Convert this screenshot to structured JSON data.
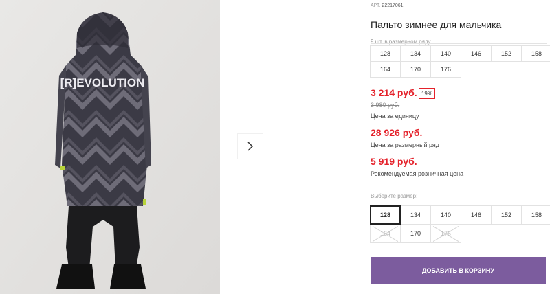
{
  "product": {
    "art_label": "АРТ.",
    "art_number": "22217061",
    "title": "Пальто зимнее для мальчика",
    "sizes_in_row": "9 шт. в размерном ряду",
    "row_sizes": [
      "128",
      "134",
      "140",
      "146",
      "152",
      "158",
      "164",
      "170",
      "176"
    ],
    "print_text": "[R]EVOLUTION"
  },
  "pricing": {
    "price": "3 214 руб.",
    "discount": "19%",
    "old_price": "3 980 руб.",
    "price_note": "Цена за единицу",
    "row_price": "28 926 руб.",
    "row_price_note": "Цена за размерный ряд",
    "retail_price": "5 919 руб.",
    "retail_note": "Рекомендуемая розничная цена"
  },
  "size_picker": {
    "label": "Выберите размер:",
    "options": [
      {
        "value": "128",
        "state": "selected"
      },
      {
        "value": "134",
        "state": "available"
      },
      {
        "value": "140",
        "state": "available"
      },
      {
        "value": "146",
        "state": "available"
      },
      {
        "value": "152",
        "state": "available"
      },
      {
        "value": "158",
        "state": "available"
      },
      {
        "value": "164",
        "state": "unavailable"
      },
      {
        "value": "170",
        "state": "available"
      },
      {
        "value": "176",
        "state": "unavailable"
      }
    ]
  },
  "actions": {
    "add_to_cart": "ДОБАВИТЬ В КОРЗИНУ"
  },
  "icons": {
    "next": "chevron-right-icon"
  },
  "colors": {
    "price": "#e4222b",
    "button": "#7c5c9e"
  }
}
